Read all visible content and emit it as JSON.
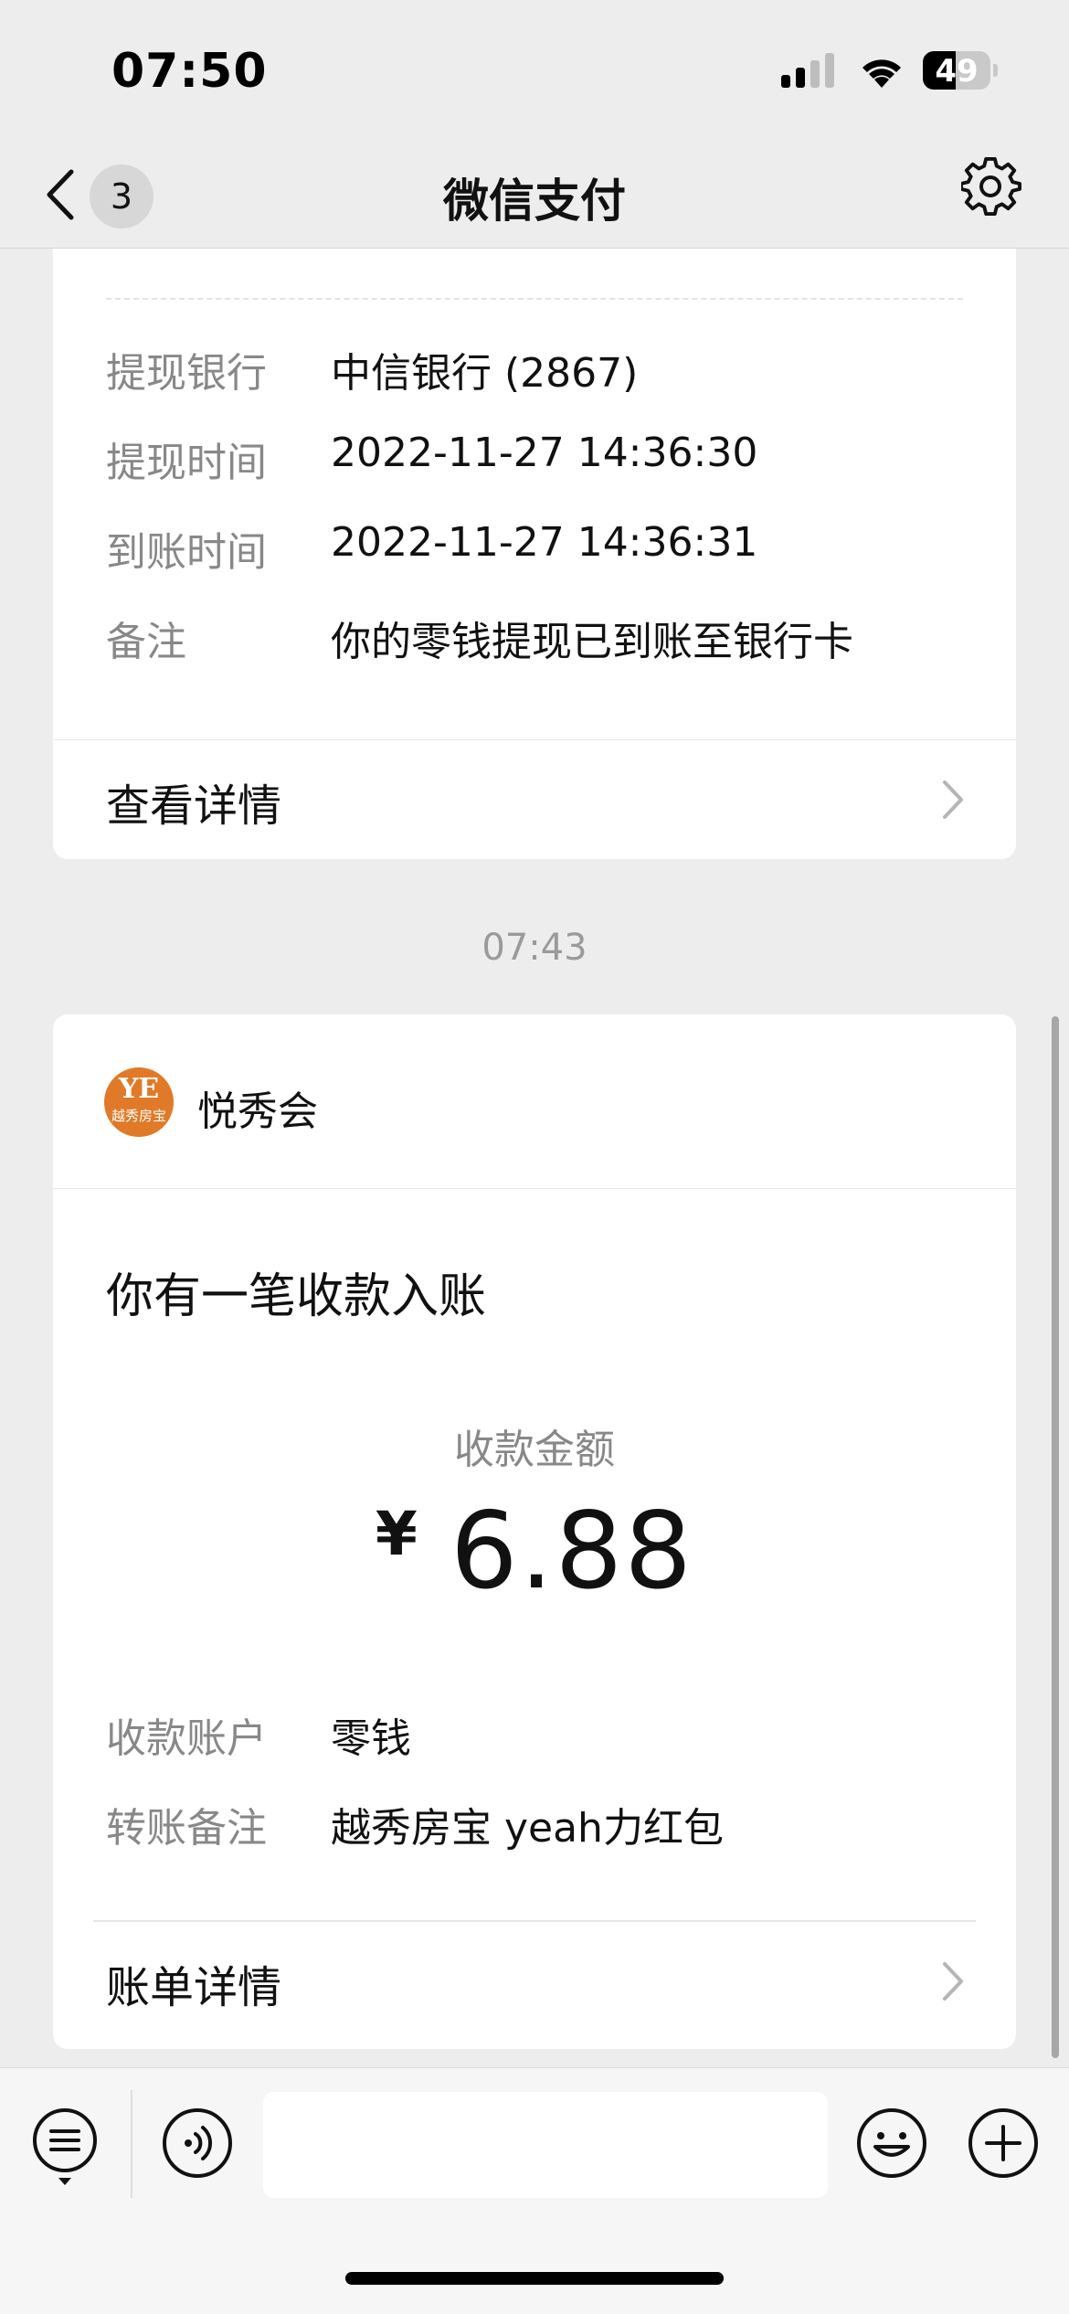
{
  "status_bar": {
    "time": "07:50",
    "battery_level": "49",
    "battery_fraction": 0.49
  },
  "nav": {
    "title": "微信支付",
    "unread_count": "3",
    "back_icon": "chevron-left-icon",
    "settings_icon": "gear-icon"
  },
  "withdraw_card": {
    "rows": [
      {
        "label": "提现银行",
        "value": "中信银行 (2867)"
      },
      {
        "label": "提现时间",
        "value": "2022-11-27 14:36:30"
      },
      {
        "label": "到账时间",
        "value": "2022-11-27 14:36:31"
      },
      {
        "label": "备注",
        "value": "你的零钱提现已到账至银行卡"
      }
    ],
    "detail_label": "查看详情"
  },
  "timestamp": "07:43",
  "payment_card": {
    "sender_name": "悦秀会",
    "avatar_mark": "YE",
    "avatar_sub": "越秀房宝",
    "message_title": "你有一笔收款入账",
    "amount_label": "收款金额",
    "currency": "¥",
    "amount": "6.88",
    "rows": [
      {
        "label": "收款账户",
        "value": "零钱"
      },
      {
        "label": "转账备注",
        "value": "越秀房宝 yeah力红包"
      }
    ],
    "detail_label": "账单详情"
  },
  "input_bar": {
    "text_value": "",
    "icons": [
      "menu-list-icon",
      "voice-icon",
      "emoji-icon",
      "plus-icon"
    ]
  },
  "colors": {
    "background": "#ededed",
    "card": "#ffffff",
    "label_gray": "#888888",
    "avatar_orange": "#e07a28"
  }
}
